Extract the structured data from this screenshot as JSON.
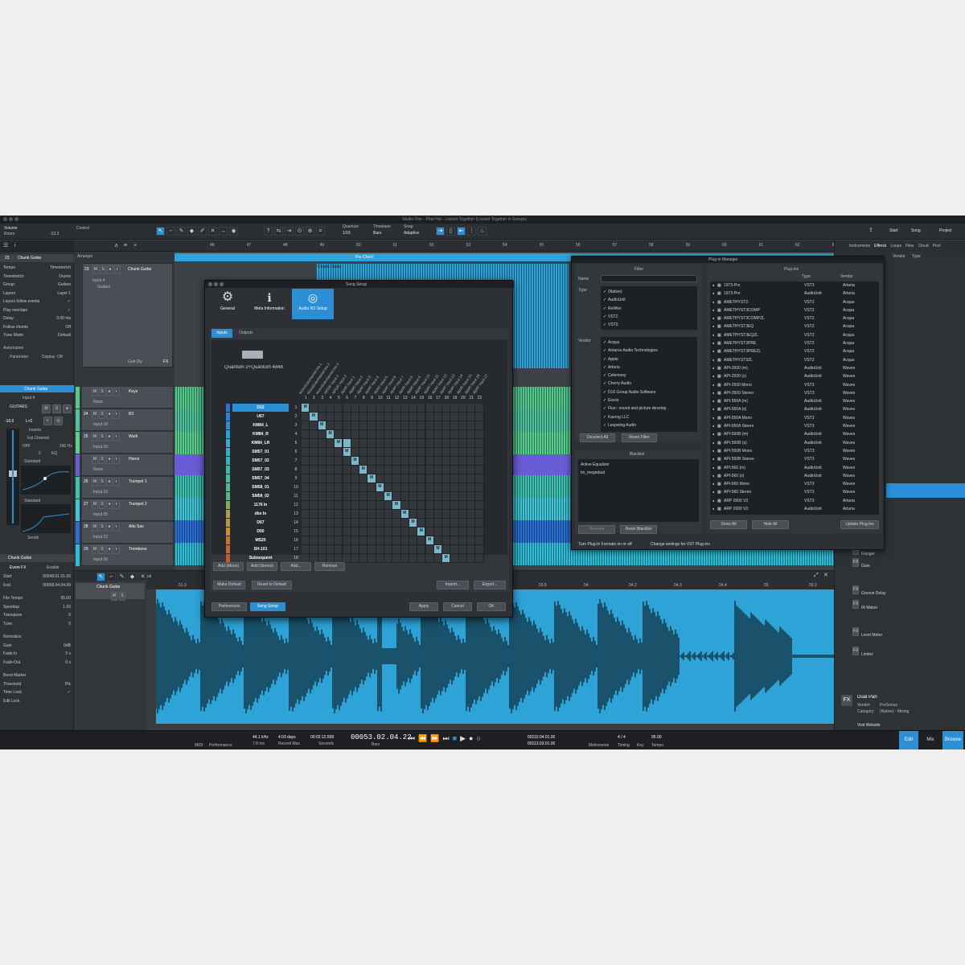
{
  "window": {
    "title": "Studio One - Phat Hat - Locked Together (Locked Together in Groups)"
  },
  "topbar": {
    "track_label": "Volume",
    "track_sub": "Room",
    "volume": "-23.3",
    "control": "Control",
    "quantize_label": "Quantize",
    "quantize": "1/16",
    "timebase_label": "Timebase",
    "timebase": "Bars",
    "snap_label": "Snap",
    "snap": "Adaptive",
    "start": "Start",
    "song": "Song",
    "project": "Project"
  },
  "ruler": [
    "46",
    "47",
    "48",
    "49",
    "50",
    "51",
    "52",
    "53",
    "54",
    "55",
    "56",
    "57",
    "58",
    "59",
    "60",
    "61",
    "62",
    "63"
  ],
  "inspector": {
    "track_no": "23",
    "track_name": "Chunk Guitar",
    "rows": [
      {
        "k": "Tempo",
        "v": "Timestretch"
      },
      {
        "k": "Timestretch",
        "v": "Drums"
      },
      {
        "k": "Group",
        "v": "Guitars"
      },
      {
        "k": "Layers",
        "v": "Layer 1"
      },
      {
        "k": "Layers follow events",
        "v": ""
      },
      {
        "k": "Play overlaps",
        "v": ""
      },
      {
        "k": "Delay",
        "v": "0.00 ms"
      },
      {
        "k": "Follow chords",
        "v": "Off"
      },
      {
        "k": "Tune Mode",
        "v": "Default"
      }
    ],
    "automation": "Automation",
    "parameter": "Parameter",
    "display": "Display: Off",
    "channel": "Chunk Guitar",
    "input": "Input 4",
    "group": "GUITARS",
    "gain": "-10.0",
    "lr": "L<0",
    "inserts": "Inserts",
    "fat_channel": "Fat Channel",
    "hpf": "HPF",
    "hz": "240 Hz",
    "zero": "0",
    "eq": "EQ",
    "standard": "Standard",
    "standard2": "Standard",
    "sends": "Sends",
    "event": {
      "title": "Chunk Guitar",
      "tab": "Event FX",
      "enable": "Enable",
      "rows": [
        {
          "k": "Start",
          "v": "00049.01.01.00"
        },
        {
          "k": "End",
          "v": "00058.04.04.99"
        },
        {
          "k": "File Tempo",
          "v": "95.00"
        },
        {
          "k": "Speedup",
          "v": "1.00"
        },
        {
          "k": "Transpose",
          "v": "0"
        },
        {
          "k": "Tune",
          "v": "0"
        },
        {
          "k": "Normalize",
          "v": ""
        },
        {
          "k": "Gain",
          "v": "0dB"
        },
        {
          "k": "Fade-In",
          "v": "0 s"
        },
        {
          "k": "Fade-Out",
          "v": "0 s"
        },
        {
          "k": "Bend Marker",
          "v": ""
        },
        {
          "k": "Threshold",
          "v": "0%"
        },
        {
          "k": "Time Lock",
          "v": ""
        },
        {
          "k": "Edit Lock",
          "v": ""
        }
      ]
    }
  },
  "tracks": [
    {
      "no": "23",
      "name": "Chunk Guitar",
      "input": "Input 4",
      "out": "Guitars",
      "fx": "Guit Dly"
    },
    {
      "no": "",
      "name": "Keys",
      "input": "None"
    },
    {
      "no": "24",
      "name": "B3",
      "input": "Input 18"
    },
    {
      "no": "25",
      "name": "Wurli",
      "input": "Input 20"
    },
    {
      "no": "",
      "name": "Horns",
      "input": "None"
    },
    {
      "no": "26",
      "name": "Trumpet 1",
      "input": "Input 15"
    },
    {
      "no": "27",
      "name": "Trumpet 2",
      "input": "Input 25"
    },
    {
      "no": "28",
      "name": "Alto Sax",
      "input": "Input 22"
    },
    {
      "no": "29",
      "name": "Trombone",
      "input": "Input 26"
    }
  ],
  "arranger": {
    "label": "Arranger",
    "section": "Pre Chor2",
    "clip": "Chunk Guitar"
  },
  "song_setup": {
    "title": "Song Setup",
    "tabs": [
      "General",
      "Meta Information",
      "Audio I/O Setup"
    ],
    "subtabs": [
      "Inputs",
      "Outputs"
    ],
    "device": "Quantum 2+Quantum 4848",
    "inputs": [
      "D12",
      "U67",
      "KM84_L",
      "KM84_R",
      "KM84_LR",
      "SM57_01",
      "SM57_02",
      "SM57_03",
      "SM57_04",
      "SM58_01",
      "SM58_02",
      "1176 In",
      "dbx In",
      "D67",
      "D50",
      "MS20",
      "SH-101",
      "Subsequent"
    ],
    "columns": [
      "1",
      "2",
      "3",
      "4",
      "5",
      "6",
      "7",
      "8",
      "9",
      "10",
      "11",
      "12",
      "13",
      "14",
      "15",
      "16",
      "17",
      "18",
      "19",
      "20",
      "21",
      "22"
    ],
    "col_headers": [
      "MonoSubchannel Ins 1",
      "MonoSubchannel Ins 2",
      "MonoSubchannel Ins 3",
      "SPDIF Input 1",
      "SPDIF Input 2",
      "ADAT Input 1",
      "ADAT Input 2",
      "ADAT Input 3",
      "ADAT Input 4",
      "ADAT Input 5",
      "ADAT Input 6",
      "ADAT Input 7",
      "ADAT Input 8",
      "ADAT Input 9",
      "ADAT Input 10",
      "ADAT Input 11",
      "ADAT Input 12",
      "ADAT Input 13",
      "ADAT Input 14",
      "ADAT Input 15",
      "ADAT Input 16",
      "ADAT Input 17"
    ],
    "marker": "M",
    "buttons": {
      "add_mono": "Add (Mono)",
      "add_stereo": "Add (Stereo)",
      "add": "Add...",
      "remove": "Remove",
      "make_default": "Make Default",
      "reset_default": "Reset to Default",
      "import": "Import...",
      "export": "Export...",
      "preferences": "Preferences",
      "song_setup": "Song Setup",
      "apply": "Apply",
      "cancel": "Cancel",
      "ok": "OK"
    }
  },
  "plugin_manager": {
    "title": "Plug-in Manager",
    "filter": "Filter",
    "name_label": "Name",
    "type_label": "Type",
    "vendor_label": "Vendor",
    "types": [
      "(Native)",
      "AudioUnit",
      "ReWire",
      "VST2",
      "VST3"
    ],
    "vendors": [
      "Acqua",
      "Antares Audio Technologies",
      "Apple",
      "Arturia",
      "Celemony",
      "Cherry Audio",
      "D16 Group Audio Software",
      "Eiosis",
      "Flux:: sound and picture develop..",
      "Kazrog LLC",
      "Lexpwing Audio"
    ],
    "deselect_all": "Deselect All",
    "reset_filter": "Reset Filter",
    "blacklist": "Blacklist",
    "blacklist_items": [
      "Active Equalizer",
      "bx_megadual"
    ],
    "remove": "Remove",
    "reset_blacklist": "Reset Blacklist",
    "plugins_title": "Plug-ins",
    "col_type": "Type",
    "col_vendor": "Vendor",
    "plugins": [
      {
        "n": "1973-Pre",
        "t": "VST3",
        "v": "Arturia"
      },
      {
        "n": "1973-Pre",
        "t": "AudioUnit",
        "v": "Arturia"
      },
      {
        "n": "AMETHYST3",
        "t": "VST2",
        "v": "Acqua"
      },
      {
        "n": "AMETHYST3COMP",
        "t": "VST2",
        "v": "Acqua"
      },
      {
        "n": "AMETHYST3COMPZL",
        "t": "VST2",
        "v": "Acqua"
      },
      {
        "n": "AMETHYST3EQ",
        "t": "VST2",
        "v": "Acqua"
      },
      {
        "n": "AMETHYST3EQZL",
        "t": "VST2",
        "v": "Acqua"
      },
      {
        "n": "AMETHYST3PRE",
        "t": "VST2",
        "v": "Acqua"
      },
      {
        "n": "AMETHYST3PREZL",
        "t": "VST2",
        "v": "Acqua"
      },
      {
        "n": "AMETHYST3ZL",
        "t": "VST2",
        "v": "Acqua"
      },
      {
        "n": "API-2500 (m)",
        "t": "AudioUnit",
        "v": "Waves"
      },
      {
        "n": "API-2500 (s)",
        "t": "AudioUnit",
        "v": "Waves"
      },
      {
        "n": "API-2500 Mono",
        "t": "VST3",
        "v": "Waves"
      },
      {
        "n": "API-2500 Stereo",
        "t": "VST3",
        "v": "Waves"
      },
      {
        "n": "API-550A (m)",
        "t": "AudioUnit",
        "v": "Waves"
      },
      {
        "n": "API-550A (s)",
        "t": "AudioUnit",
        "v": "Waves"
      },
      {
        "n": "API-550A Mono",
        "t": "VST3",
        "v": "Waves"
      },
      {
        "n": "API-550A Stereo",
        "t": "VST3",
        "v": "Waves"
      },
      {
        "n": "API-550B (m)",
        "t": "AudioUnit",
        "v": "Waves"
      },
      {
        "n": "API-550B (s)",
        "t": "AudioUnit",
        "v": "Waves"
      },
      {
        "n": "API-550B Mono",
        "t": "VST3",
        "v": "Waves"
      },
      {
        "n": "API-550B Stereo",
        "t": "VST3",
        "v": "Waves"
      },
      {
        "n": "API-560 (m)",
        "t": "AudioUnit",
        "v": "Waves"
      },
      {
        "n": "API-560 (s)",
        "t": "AudioUnit",
        "v": "Waves"
      },
      {
        "n": "API-560 Mono",
        "t": "VST3",
        "v": "Waves"
      },
      {
        "n": "API-560 Stereo",
        "t": "VST3",
        "v": "Waves"
      },
      {
        "n": "ARP 2600 V3",
        "t": "VST3",
        "v": "Arturia"
      },
      {
        "n": "ARP 2600 V3",
        "t": "AudioUnit",
        "v": "Arturia"
      }
    ],
    "show_all": "Show All",
    "hide_all": "Hide All",
    "update": "Update Plug-ins",
    "footer1": "Turn Plug-In Formats on or off",
    "footer2": "Change settings for VST Plug-ins"
  },
  "browser": {
    "tabs": [
      "Instruments",
      "Effects",
      "Loops",
      "Files",
      "Cloud",
      "Pool"
    ],
    "sort1": "Vendor",
    "sort2": "Type",
    "items": [
      "Flanger",
      "Gate",
      "Groove Delay",
      "IR Maker",
      "Level Meter",
      "Limiter"
    ],
    "selected": "Dual Pan",
    "vendor_label": "Vendor:",
    "vendor": "PreSonus",
    "category_label": "Category:",
    "category": "(Native) - Mixing",
    "visit": "Visit Website"
  },
  "editor": {
    "track": "Chunk Guitar",
    "ruler": [
      "51.3",
      "51.5",
      "52",
      "52.2",
      "52.3",
      "52.4",
      "53",
      "53.3",
      "53.5",
      "54",
      "54.2",
      "54.3",
      "54.4",
      "55",
      "55.2"
    ],
    "normal": "Normal"
  },
  "transport": {
    "midi": "MIDI",
    "performance": "Performance",
    "rate": "44.1 kHz",
    "lat": "7.8 ms",
    "days": "4.03 days",
    "rec_max": "Record Max",
    "seconds_val": "00:02:12.509",
    "seconds": "Seconds",
    "bars_val": "00053.02.04.22",
    "bars": "Bars",
    "l": "00110.04.01.00",
    "r": "00113.03.01.00",
    "metronome": "Metronome",
    "sig": "4 / 4",
    "timing": "Timing",
    "key": "Key",
    "tempo_val": "95.00",
    "tempo": "Tempo",
    "edit": "Edit",
    "mix": "Mix",
    "browse": "Browse"
  },
  "colors": {
    "accent": "#2c8fd6",
    "clip_blue": "#2ea3d8",
    "green": "#55c98a",
    "purple": "#6a5bd6"
  }
}
